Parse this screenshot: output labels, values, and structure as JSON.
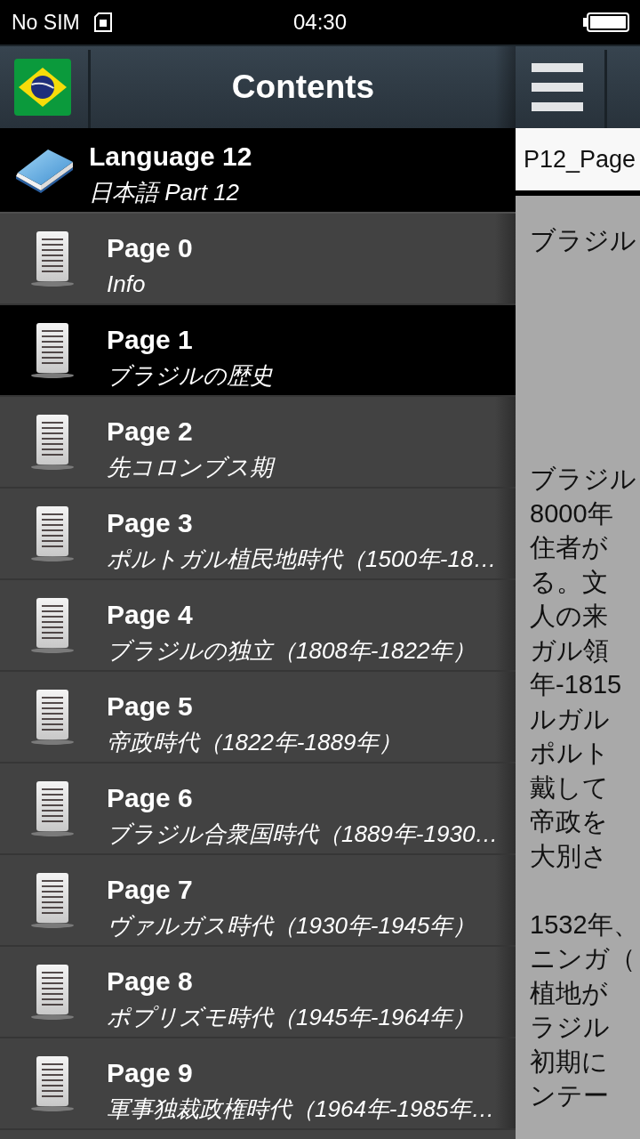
{
  "status_bar": {
    "carrier": "No SIM",
    "time": "04:30"
  },
  "drawer": {
    "title": "Contents",
    "book": {
      "title": "Language 12",
      "subtitle": "日本語 Part 12"
    },
    "pages": [
      {
        "title": "Page 0",
        "subtitle": "Info",
        "selected": false
      },
      {
        "title": "Page 1",
        "subtitle": "ブラジルの歴史",
        "selected": true
      },
      {
        "title": "Page 2",
        "subtitle": "先コロンブス期",
        "selected": false
      },
      {
        "title": "Page 3",
        "subtitle": "ポルトガル植民地時代（1500年-18…",
        "selected": false
      },
      {
        "title": "Page 4",
        "subtitle": "ブラジルの独立（1808年-1822年）",
        "selected": false
      },
      {
        "title": "Page 5",
        "subtitle": "帝政時代（1822年-1889年）",
        "selected": false
      },
      {
        "title": "Page 6",
        "subtitle": "ブラジル合衆国時代（1889年-1930…",
        "selected": false
      },
      {
        "title": "Page 7",
        "subtitle": "ヴァルガス時代（1930年-1945年）",
        "selected": false
      },
      {
        "title": "Page 8",
        "subtitle": "ポプリズモ時代（1945年-1964年）",
        "selected": false
      },
      {
        "title": "Page 9",
        "subtitle": "軍事独裁政権時代（1964年-1985年…",
        "selected": false
      }
    ]
  },
  "content": {
    "page_title": "P12_Page",
    "heading": "ブラジル",
    "paragraphs": [
      [
        "ブラジル",
        "8000年",
        "住者が",
        "る。文",
        "人の来",
        "ガル領",
        "年-1815",
        "ルガル",
        "ポルト",
        "戴して",
        "帝政を",
        "大別さ"
      ],
      [
        "1532年、",
        "ニンガ（",
        "植地が",
        "ラジル",
        "初期に",
        "ンテー"
      ]
    ]
  }
}
